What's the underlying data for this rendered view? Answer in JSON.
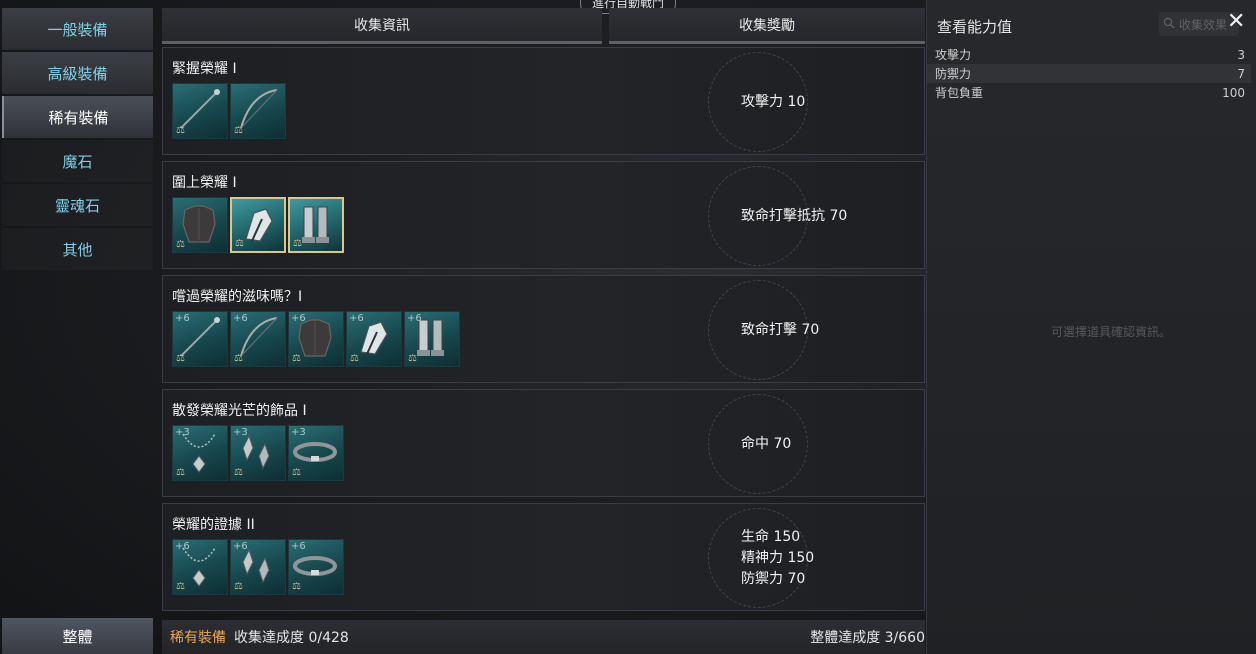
{
  "top": {
    "auto_battle": "進行自動戰鬥"
  },
  "nav": {
    "items": [
      {
        "label": "一般裝備"
      },
      {
        "label": "高級裝備"
      },
      {
        "label": "稀有裝備"
      },
      {
        "label": "魔石"
      },
      {
        "label": "靈魂石"
      },
      {
        "label": "其他"
      }
    ],
    "active": "稀有裝備",
    "bottom": "整體"
  },
  "headers": {
    "info": "收集資訊",
    "reward": "收集獎勵"
  },
  "collections": [
    {
      "title": "緊握榮耀 I",
      "items": [
        {
          "icon": "staff-icon",
          "plus": ""
        },
        {
          "icon": "bow-icon",
          "plus": ""
        }
      ],
      "rewards": [
        "攻擊力 10"
      ]
    },
    {
      "title": "圍上榮耀 I",
      "items": [
        {
          "icon": "armor-icon",
          "plus": ""
        },
        {
          "icon": "gloves-icon",
          "plus": "",
          "highlight": true
        },
        {
          "icon": "boots-icon",
          "plus": "",
          "highlight": true
        }
      ],
      "rewards": [
        "致命打擊抵抗 70"
      ]
    },
    {
      "title": "嚐過榮耀的滋味嗎？I",
      "items": [
        {
          "icon": "staff-icon",
          "plus": "+6"
        },
        {
          "icon": "bow-icon",
          "plus": "+6"
        },
        {
          "icon": "armor-icon",
          "plus": "+6"
        },
        {
          "icon": "gloves-icon",
          "plus": "+6"
        },
        {
          "icon": "boots-icon",
          "plus": "+6"
        }
      ],
      "rewards": [
        "致命打擊 70"
      ]
    },
    {
      "title": "散發榮耀光芒的飾品 I",
      "items": [
        {
          "icon": "necklace-icon",
          "plus": "+3"
        },
        {
          "icon": "earring-icon",
          "plus": "+3"
        },
        {
          "icon": "belt-icon",
          "plus": "+3"
        }
      ],
      "rewards": [
        "命中 70"
      ]
    },
    {
      "title": "榮耀的證據 II",
      "items": [
        {
          "icon": "necklace-icon",
          "plus": "+6"
        },
        {
          "icon": "earring-icon",
          "plus": "+6"
        },
        {
          "icon": "belt-icon",
          "plus": "+6"
        }
      ],
      "rewards": [
        "生命 150",
        "精神力 150",
        "防禦力 70"
      ]
    }
  ],
  "footer": {
    "category": "稀有裝備",
    "progress_label": "收集達成度 0/428",
    "total_label": "整體達成度 3/660"
  },
  "panel": {
    "title": "查看能力值",
    "search_placeholder": "收集效果",
    "close": "✕",
    "stats": [
      {
        "name": "攻擊力",
        "value": "3"
      },
      {
        "name": "防禦力",
        "value": "7"
      },
      {
        "name": "背包負重",
        "value": "100"
      }
    ],
    "hint": "可選擇道具確認資訊。"
  },
  "colors": {
    "nav_text": "#7fd0e6",
    "category_accent": "#e8a556",
    "item_teal": "#1f5d63",
    "highlight_border": "#d9c88a"
  }
}
